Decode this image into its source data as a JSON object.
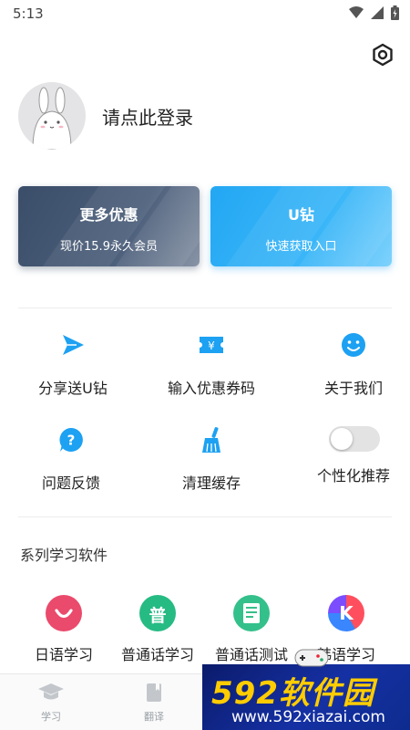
{
  "status_bar": {
    "time": "5:13"
  },
  "profile": {
    "login_prompt": "请点此登录"
  },
  "promos": [
    {
      "title": "更多优惠",
      "subtitle": "现价15.9永久会员"
    },
    {
      "title": "U钻",
      "subtitle": "快速获取入口"
    }
  ],
  "grid": [
    {
      "label": "分享送U钻",
      "icon": "send-icon"
    },
    {
      "label": "输入优惠券码",
      "icon": "coupon-icon"
    },
    {
      "label": "关于我们",
      "icon": "smiley-icon"
    },
    {
      "label": "问题反馈",
      "icon": "question-icon"
    },
    {
      "label": "清理缓存",
      "icon": "broom-icon"
    },
    {
      "label": "个性化推荐",
      "icon": "toggle-switch",
      "toggle_on": false
    }
  ],
  "apps_section": {
    "title": "系列学习软件",
    "apps": [
      {
        "label": "日语学习",
        "icon": "smile-icon"
      },
      {
        "label": "普通话学习",
        "icon_text": "普",
        "icon": "pu-icon"
      },
      {
        "label": "普通话测试",
        "icon": "document-icon"
      },
      {
        "label": "韩语学习",
        "icon_text": "K",
        "icon": "k-icon"
      }
    ]
  },
  "bottom_nav": [
    {
      "label": "学习",
      "icon": "graduation-cap-icon"
    },
    {
      "label": "翻译",
      "icon": "book-icon"
    }
  ],
  "watermark": {
    "brand": "592软件园",
    "url": "www.592xiazai.com"
  },
  "colors": {
    "accent_blue": "#1da1f2",
    "dark_card": "#3a4d69",
    "blue_card": "#23a7f3",
    "pink": "#ea4a6c",
    "green": "#26bb83"
  }
}
